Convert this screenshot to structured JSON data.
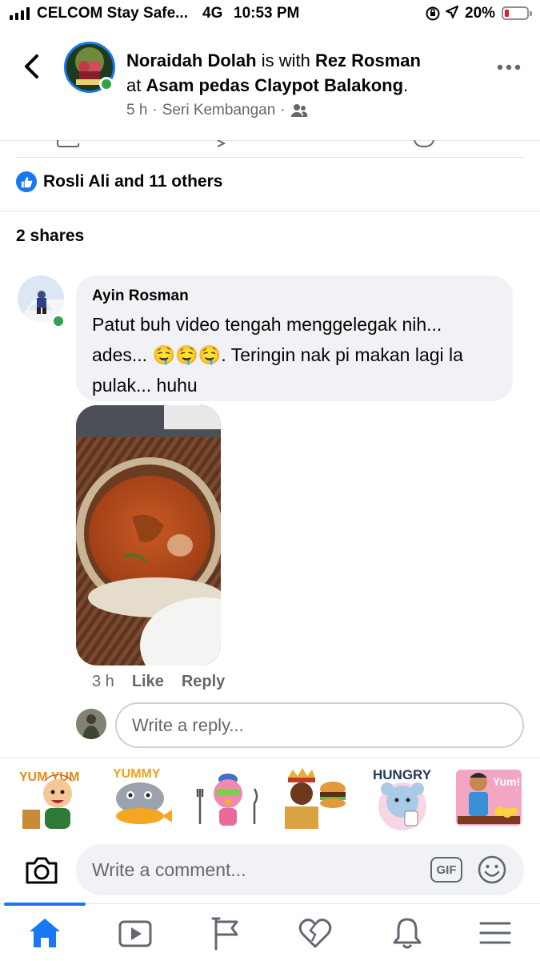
{
  "status_bar": {
    "carrier": "CELCOM Stay Safe...",
    "network": "4G",
    "time": "10:53 PM",
    "battery_percent": "20%",
    "battery_level": 0.2
  },
  "post_header": {
    "author": "Noraidah Dolah",
    "with_text": " is with ",
    "tagged": "Rez Rosman",
    "at_text": "at ",
    "place": "Asam pedas Claypot Balakong",
    "place_end": ".",
    "time_ago": "5 h",
    "location": "Seri Kembangan",
    "sep": "·",
    "audience_icon": "friends-icon"
  },
  "reactions": {
    "summary": "Rosli Ali and 11 others"
  },
  "shares": {
    "text": "2 shares"
  },
  "comment": {
    "name": "Ayin Rosman",
    "text_part1": "Patut buh video tengah menggelegak nih... ades... ",
    "emojis": "🤤🤤🤤",
    "text_part2": ". Teringin nak pi makan lagi la pulak... huhu",
    "time": "3 h",
    "like_label": "Like",
    "reply_label": "Reply"
  },
  "reply_input": {
    "placeholder": "Write a reply..."
  },
  "stickers": {
    "items": [
      "YUM YUM YUM",
      "YUMMY",
      "",
      "",
      "HUNGRY",
      "Yum!"
    ]
  },
  "composer": {
    "placeholder": "Write a comment...",
    "gif_label": "GIF"
  },
  "tabs": [
    "home",
    "watch",
    "pages",
    "dating",
    "notifications",
    "menu"
  ],
  "colors": {
    "accent": "#1877f2",
    "online": "#31a24c",
    "secondary_text": "#65676b"
  }
}
